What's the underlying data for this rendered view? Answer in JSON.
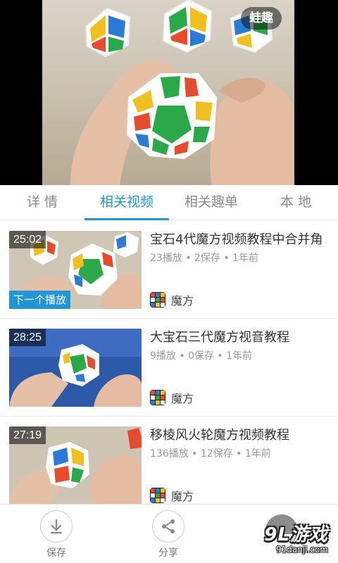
{
  "player": {
    "watermark": "蛙趣"
  },
  "tabs": [
    {
      "label": "详 情",
      "active": false
    },
    {
      "label": "相关视频",
      "active": true
    },
    {
      "label": "相关趣单",
      "active": false
    },
    {
      "label": "本 地",
      "active": false
    }
  ],
  "videos": [
    {
      "duration": "25:02",
      "next_badge": "下一个播放",
      "title": "宝石4代魔方视频教程中合并角",
      "meta": "23播放 • 2保存 • 1年前",
      "channel": "魔方"
    },
    {
      "duration": "28:25",
      "title": "大宝石三代魔方视音教程",
      "meta": "9播放 • 0保存 • 1年前",
      "channel": "魔方"
    },
    {
      "duration": "27:19",
      "title": "移棱风火轮魔方视频教程",
      "meta": "136播放 • 12保存 • 1年前",
      "channel": "魔方"
    }
  ],
  "actions": {
    "save_label": "保存",
    "share_label": "分享"
  },
  "logo": {
    "main": "9L游戏",
    "sub": "91danji.com"
  },
  "colors": {
    "accent": "#2196d6",
    "text_secondary": "#9a9a9a"
  },
  "icons": {
    "save": "download-arrow-icon",
    "share": "share-icon"
  }
}
